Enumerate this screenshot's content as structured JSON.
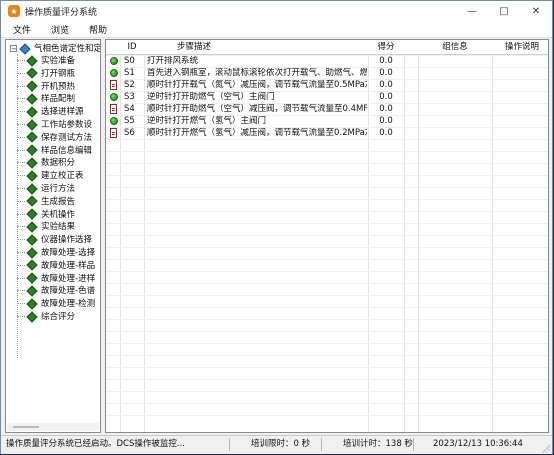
{
  "window": {
    "title": "操作质量评分系统"
  },
  "menu": [
    "文件",
    "浏览",
    "帮助"
  ],
  "tree": {
    "root_label": "气相色谱定性和定",
    "items": [
      "实验准备",
      "打开钢瓶",
      "开机预热",
      "样品配制",
      "选择进样源",
      "工作站参数设",
      "保存测试方法",
      "样品信息编辑",
      "数据积分",
      "建立校正表",
      "运行方法",
      "生成报告",
      "关机操作",
      "实验结果",
      "仪器操作选择",
      "故障处理-选择",
      "故障处理-样品",
      "故障处理-进样",
      "故障处理-色谱",
      "故障处理-检测",
      "综合评分"
    ]
  },
  "grid": {
    "columns": {
      "id": "ID",
      "desc": "步骤描述",
      "score": "得分",
      "group": "组信息",
      "op": "操作说明"
    },
    "rows": [
      {
        "icon": "green-dot-icon",
        "id": "S0",
        "desc": "打开排风系统",
        "score": "0.0"
      },
      {
        "icon": "green-dot-icon",
        "id": "S1",
        "desc": "首先进入钢瓶室，滚动鼠标滚轮依次打开载气、助燃气、燃…",
        "score": "0.0"
      },
      {
        "icon": "document-icon",
        "id": "S2",
        "desc": "顺时针打开载气（氮气）减压阀，调节载气流量至0.5MPa左右",
        "score": "0.0"
      },
      {
        "icon": "green-dot-icon",
        "id": "S3",
        "desc": "逆时针打开助燃气（空气）主阀门",
        "score": "0.0"
      },
      {
        "icon": "document-icon",
        "id": "S4",
        "desc": "顺时针打开助燃气（空气）减压阀，调节载气流量至0.4MPa左右",
        "score": "0.0"
      },
      {
        "icon": "green-dot-icon",
        "id": "S5",
        "desc": "逆时针打开燃气（氢气）主阀门",
        "score": "0.0"
      },
      {
        "icon": "document-icon",
        "id": "S6",
        "desc": "顺时针打开燃气（氢气）减压阀，调节载气流量至0.2MPa左右",
        "score": "0.0"
      }
    ]
  },
  "status": {
    "message": "操作质量评分系统已经启动。DCS操作被监控...",
    "limit": "培训限时：0 秒",
    "elapsed": "培训计时：138 秒",
    "datetime": "2023/12/13 10:36:44"
  }
}
